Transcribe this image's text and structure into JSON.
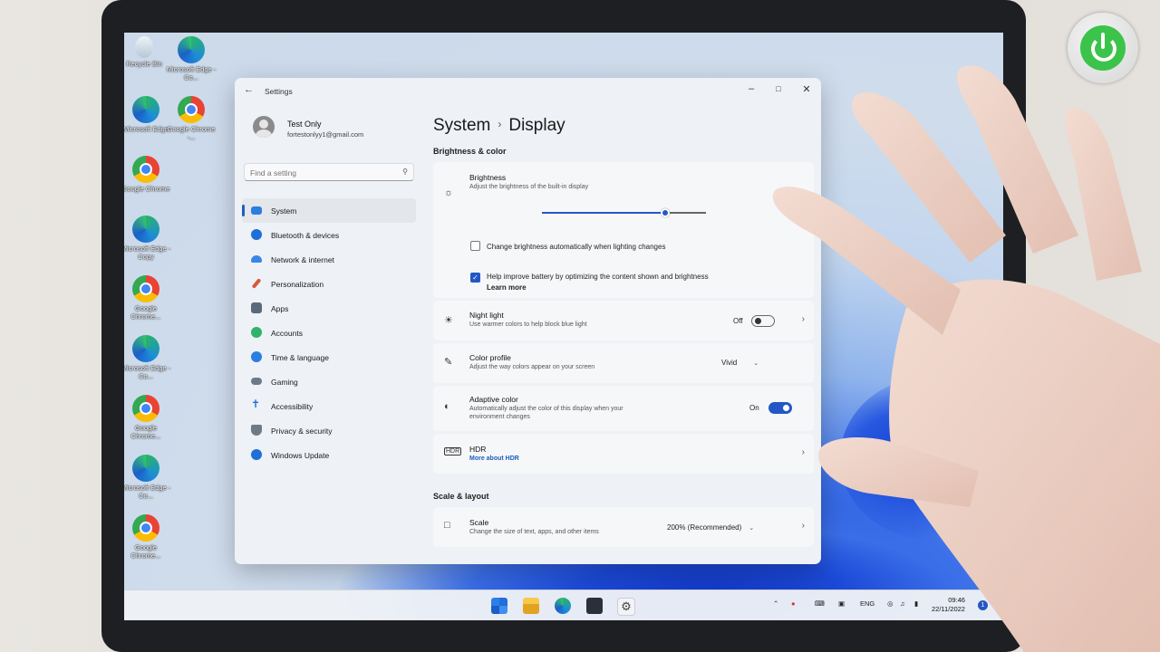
{
  "window": {
    "title": "Settings"
  },
  "profile": {
    "name": "Test Only",
    "email": "fortestonlyy1@gmail.com"
  },
  "search": {
    "placeholder": "Find a setting"
  },
  "nav": [
    {
      "label": "System",
      "active": true,
      "color": "#2b7de0"
    },
    {
      "label": "Bluetooth & devices",
      "color": "#1f6fd6"
    },
    {
      "label": "Network & internet",
      "color": "#3a86e8"
    },
    {
      "label": "Personalization",
      "color": "#d65a3a"
    },
    {
      "label": "Apps",
      "color": "#5a6a7a"
    },
    {
      "label": "Accounts",
      "color": "#2fb36a"
    },
    {
      "label": "Time & language",
      "color": "#2b7de0"
    },
    {
      "label": "Gaming",
      "color": "#6a7a8a"
    },
    {
      "label": "Accessibility",
      "color": "#1f6fd6"
    },
    {
      "label": "Privacy & security",
      "color": "#707a84"
    },
    {
      "label": "Windows Update",
      "color": "#1f6fd6"
    }
  ],
  "breadcrumb": {
    "parent": "System",
    "current": "Display"
  },
  "brightness_color": {
    "heading": "Brightness & color",
    "brightness": {
      "title": "Brightness",
      "subtitle": "Adjust the brightness of the built-in display",
      "level_percent": 75
    },
    "auto_brightness": {
      "label": "Change brightness automatically when lighting changes",
      "checked": false
    },
    "battery_content": {
      "label": "Help improve battery by optimizing the content shown and brightness",
      "link": "Learn more",
      "checked": true
    },
    "night_light": {
      "title": "Night light",
      "subtitle": "Use warmer colors to help block blue light",
      "state": "Off"
    },
    "color_profile": {
      "title": "Color profile",
      "subtitle": "Adjust the way colors appear on your screen",
      "value": "Vivid"
    },
    "adaptive_color": {
      "title": "Adaptive color",
      "subtitle": "Automatically adjust the color of this display when your",
      "subtitle2": "environment changes",
      "state": "On"
    },
    "hdr": {
      "title": "HDR",
      "link": "More about HDR"
    }
  },
  "scale_layout": {
    "heading": "Scale & layout",
    "scale": {
      "title": "Scale",
      "subtitle": "Change the size of text, apps, and other items",
      "value": "200% (Recommended)"
    }
  },
  "desktop_icons": [
    {
      "label": "Recycle Bin",
      "icon": "recycle-bin-icon"
    },
    {
      "label": "Microsoft Edge - Co...",
      "icon": "edge-icon"
    },
    {
      "label": "Microsoft Edge",
      "icon": "edge-icon"
    },
    {
      "label": "Google Chrome -...",
      "icon": "chrome-icon"
    },
    {
      "label": "Google Chrome",
      "icon": "chrome-icon"
    },
    {
      "label": "Microsoft Edge - Copy",
      "icon": "edge-icon"
    },
    {
      "label": "Google Chrome...",
      "icon": "chrome-icon"
    },
    {
      "label": "Microsoft Edge - Co...",
      "icon": "edge-icon"
    },
    {
      "label": "Google Chrome...",
      "icon": "chrome-icon"
    },
    {
      "label": "Microsoft Edge - Co...",
      "icon": "edge-icon"
    },
    {
      "label": "Google Chrome...",
      "icon": "chrome-icon"
    }
  ],
  "taskbar": {
    "language": "ENG",
    "time": "09:46",
    "date": "22/11/2022",
    "notifications": "1"
  },
  "colors": {
    "accent": "#2457c5",
    "window_bg": "#eef1f6",
    "card_bg": "#f6f7f9"
  }
}
